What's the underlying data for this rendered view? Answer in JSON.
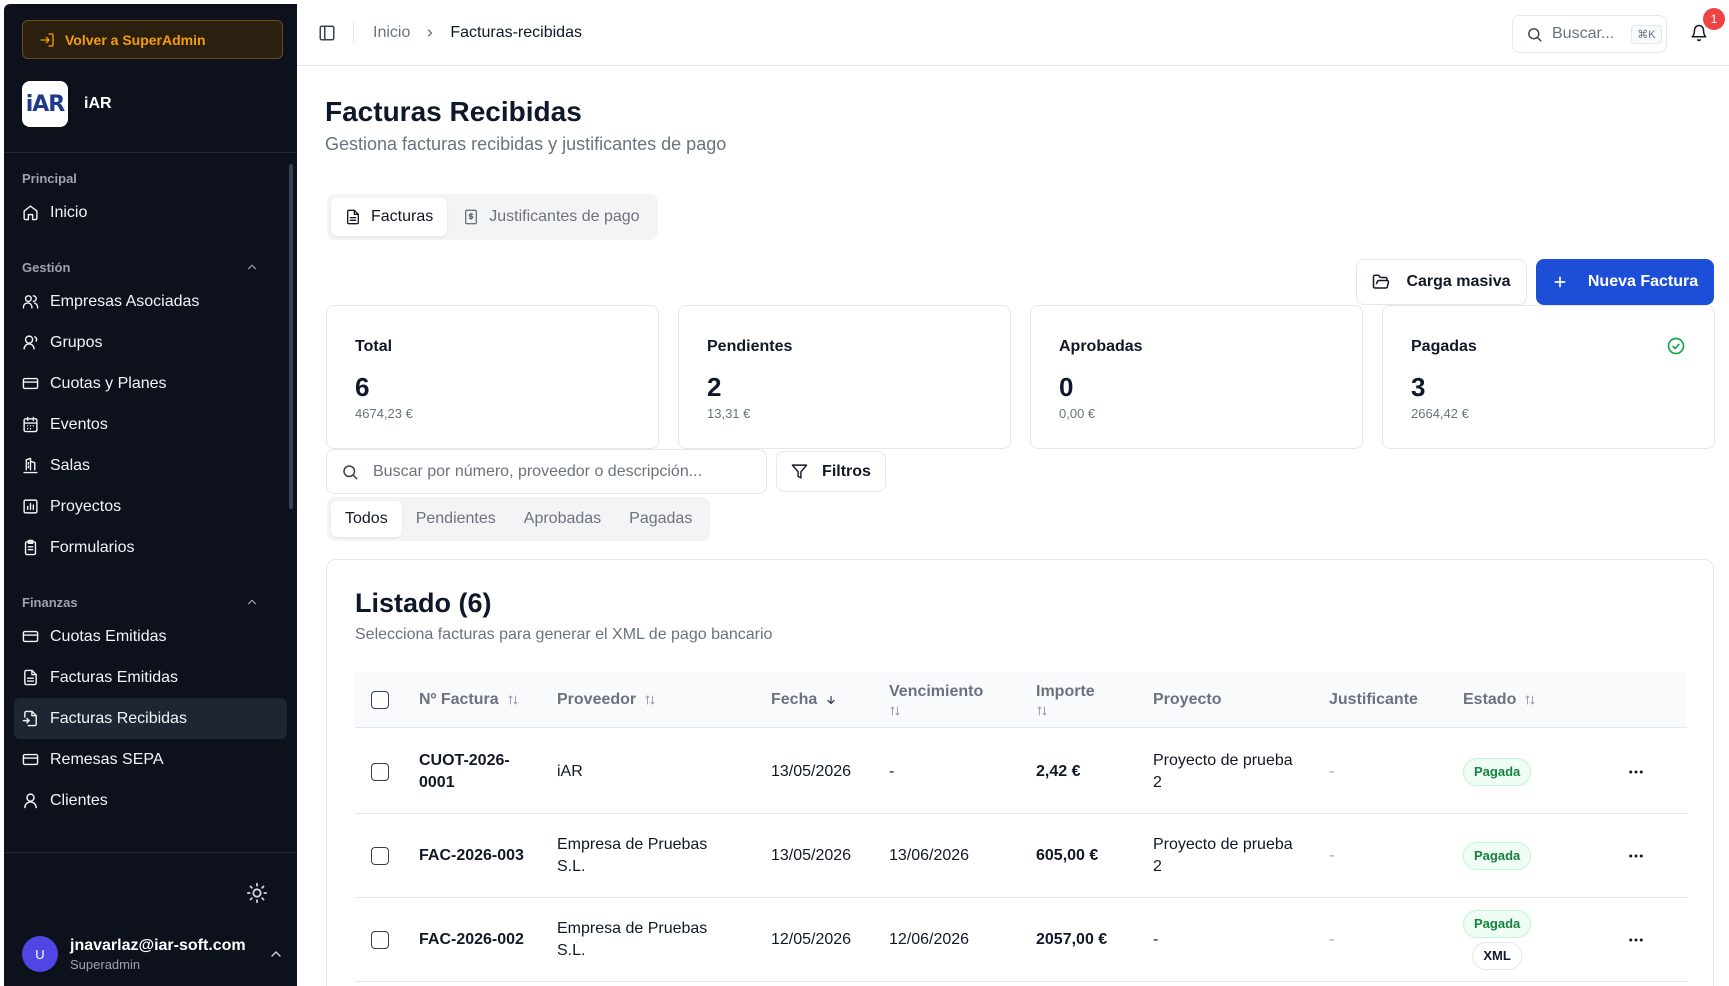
{
  "sidebar": {
    "back_label": "Volver a SuperAdmin",
    "brand": {
      "logo_text": "iAR",
      "name": "iAR"
    },
    "groups": [
      {
        "title": "Principal",
        "collapsible": false,
        "items": [
          {
            "label": "Inicio",
            "icon": "home-icon"
          }
        ]
      },
      {
        "title": "Gestión",
        "collapsible": true,
        "items": [
          {
            "label": "Empresas Asociadas",
            "icon": "users-icon"
          },
          {
            "label": "Grupos",
            "icon": "user-group-icon"
          },
          {
            "label": "Cuotas y Planes",
            "icon": "credit-card-icon"
          },
          {
            "label": "Eventos",
            "icon": "calendar-icon"
          },
          {
            "label": "Salas",
            "icon": "building-icon"
          },
          {
            "label": "Proyectos",
            "icon": "chart-icon"
          },
          {
            "label": "Formularios",
            "icon": "clipboard-icon"
          }
        ]
      },
      {
        "title": "Finanzas",
        "collapsible": true,
        "items": [
          {
            "label": "Cuotas Emitidas",
            "icon": "credit-card-icon"
          },
          {
            "label": "Facturas Emitidas",
            "icon": "file-icon"
          },
          {
            "label": "Facturas Recibidas",
            "icon": "file-input-icon",
            "active": true
          },
          {
            "label": "Remesas SEPA",
            "icon": "credit-card-icon"
          },
          {
            "label": "Clientes",
            "icon": "user-icon"
          }
        ]
      }
    ],
    "user": {
      "initial": "U",
      "email": "jnavarlaz@iar-soft.com",
      "role": "Superadmin"
    }
  },
  "topbar": {
    "breadcrumb": [
      "Inicio",
      "Facturas-recibidas"
    ],
    "search_placeholder": "Buscar...",
    "search_shortcut": "⌘K",
    "notifications": "1"
  },
  "page": {
    "title": "Facturas Recibidas",
    "subtitle": "Gestiona facturas recibidas y justificantes de pago",
    "tabs": [
      "Facturas",
      "Justificantes de pago"
    ],
    "bulk_label": "Carga masiva",
    "new_label": "Nueva Factura"
  },
  "stats": [
    {
      "label": "Total",
      "value": "6",
      "amount": "4674,23 €"
    },
    {
      "label": "Pendientes",
      "value": "2",
      "amount": "13,31 €"
    },
    {
      "label": "Aprobadas",
      "value": "0",
      "amount": "0,00 €"
    },
    {
      "label": "Pagadas",
      "value": "3",
      "amount": "2664,42 €"
    }
  ],
  "filters": {
    "search_placeholder": "Buscar por número, proveedor o descripción...",
    "filter_label": "Filtros",
    "status_tabs": [
      "Todos",
      "Pendientes",
      "Aprobadas",
      "Pagadas"
    ]
  },
  "list": {
    "title": "Listado (6)",
    "subtitle": "Selecciona facturas para generar el XML de pago bancario",
    "columns": [
      "Nº Factura",
      "Proveedor",
      "Fecha",
      "Vencimiento",
      "Importe",
      "Proyecto",
      "Justificante",
      "Estado"
    ],
    "rows": [
      {
        "number": [
          "CUOT-2026-",
          "0001"
        ],
        "provider": [
          "iAR"
        ],
        "date": "13/05/2026",
        "due": "-",
        "amount": "2,42 €",
        "project": [
          "Proyecto de prueba",
          "2"
        ],
        "receipt": "-",
        "status": "Pagada",
        "extra_badge": ""
      },
      {
        "number": [
          "FAC-2026-003"
        ],
        "provider": [
          "Empresa de Pruebas",
          "S.L."
        ],
        "date": "13/05/2026",
        "due": "13/06/2026",
        "amount": "605,00 €",
        "project": [
          "Proyecto de prueba",
          "2"
        ],
        "receipt": "-",
        "status": "Pagada",
        "extra_badge": ""
      },
      {
        "number": [
          "FAC-2026-002"
        ],
        "provider": [
          "Empresa de Pruebas",
          "S.L."
        ],
        "date": "12/05/2026",
        "due": "12/06/2026",
        "amount": "2057,00 €",
        "project": [
          "-"
        ],
        "receipt": "-",
        "status": "Pagada",
        "extra_badge": "XML"
      }
    ]
  }
}
